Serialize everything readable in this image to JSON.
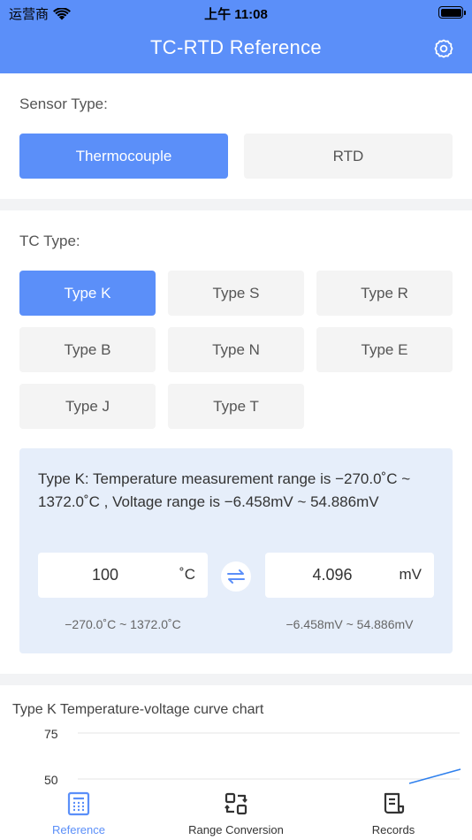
{
  "status_bar": {
    "carrier": "运营商",
    "time": "上午 11:08"
  },
  "header": {
    "title": "TC-RTD Reference"
  },
  "sensor": {
    "label": "Sensor Type:",
    "options": [
      "Thermocouple",
      "RTD"
    ],
    "selected": "Thermocouple"
  },
  "tc": {
    "label": "TC Type:",
    "options": [
      "Type K",
      "Type S",
      "Type R",
      "Type B",
      "Type N",
      "Type E",
      "Type J",
      "Type T"
    ],
    "selected": "Type K"
  },
  "info": {
    "description": "Type K: Temperature measurement range is −270.0˚C ~ 1372.0˚C , Voltage range is −6.458mV ~ 54.886mV",
    "temp_value": "100",
    "temp_unit": "˚C",
    "volt_value": "4.096",
    "volt_unit": "mV",
    "temp_range": "−270.0˚C ~ 1372.0˚C",
    "volt_range": "−6.458mV ~ 54.886mV"
  },
  "chart_data": {
    "type": "line",
    "title": "Type K Temperature-voltage curve chart",
    "y_ticks": [
      75,
      50
    ],
    "grid": true
  },
  "tabbar": {
    "items": [
      {
        "label": "Reference",
        "icon": "calculator-icon"
      },
      {
        "label": "Range Conversion",
        "icon": "convert-icon"
      },
      {
        "label": "Records",
        "icon": "records-icon"
      }
    ],
    "active": "Reference"
  },
  "colors": {
    "accent": "#5b8ff9",
    "button_bg": "#f4f4f4",
    "info_bg": "#e6eefa"
  }
}
